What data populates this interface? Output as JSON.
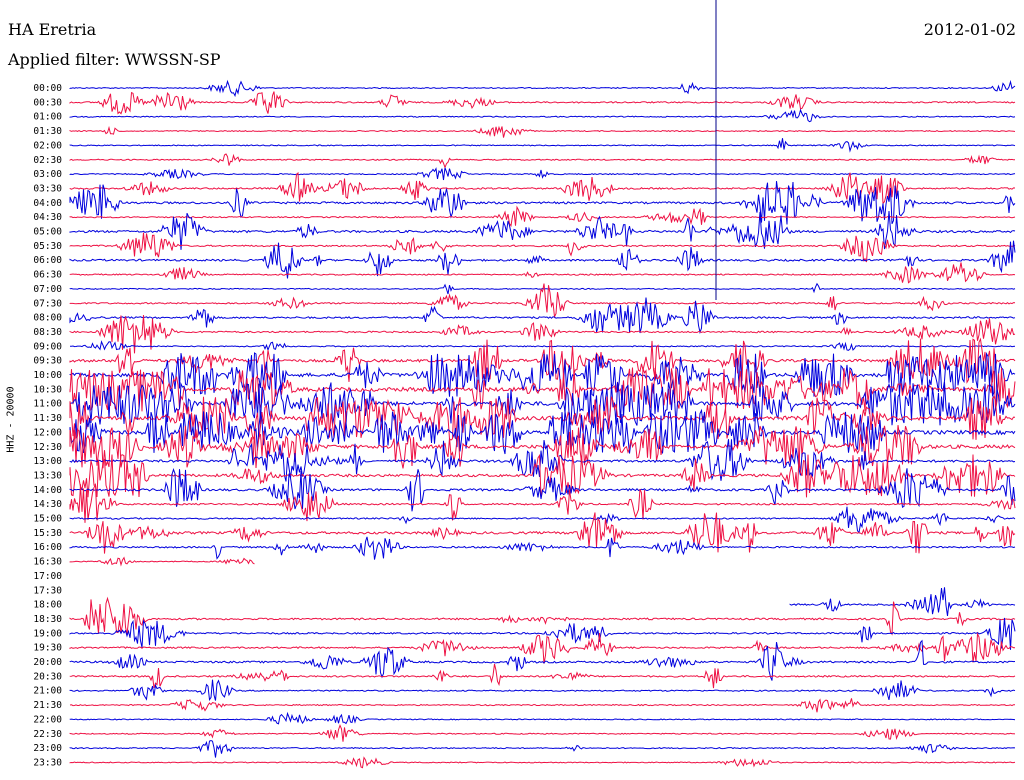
{
  "header": {
    "station": "HA Eretria",
    "filter": "Applied filter: WWSSN-SP",
    "date": "2012-01-02",
    "channel_label": "HHZ - 20000"
  },
  "colors": {
    "odd_trace": "#0000dd",
    "even_trace": "#ee1144",
    "marker_line": "#000088"
  },
  "chart_data": {
    "type": "line",
    "title": "HA Eretria",
    "subtitle": "Applied filter: WWSSN-SP",
    "ylabel": "HHZ - 20000",
    "y_tick_labels": [
      "00:00",
      "00:30",
      "01:00",
      "01:30",
      "02:00",
      "02:30",
      "03:00",
      "03:30",
      "04:00",
      "04:30",
      "05:00",
      "05:30",
      "06:00",
      "06:30",
      "07:00",
      "07:30",
      "08:00",
      "08:30",
      "09:00",
      "09:30",
      "10:00",
      "10:30",
      "11:00",
      "11:30",
      "12:00",
      "12:30",
      "13:00",
      "13:30",
      "14:00",
      "14:30",
      "15:00",
      "15:30",
      "16:00",
      "16:30",
      "17:00",
      "17:30",
      "18:00",
      "18:30",
      "19:00",
      "19:30",
      "20:00",
      "20:30",
      "21:00",
      "21:30",
      "22:00",
      "22:30",
      "23:00",
      "23:30"
    ],
    "row_activity": [
      0.8,
      2.0,
      0.6,
      0.7,
      0.6,
      1.0,
      0.8,
      2.5,
      4.0,
      1.2,
      4.5,
      2.2,
      3.5,
      1.5,
      0.5,
      2.0,
      3.0,
      2.5,
      1.0,
      6.0,
      9.0,
      10.0,
      10.0,
      10.0,
      10.0,
      9.0,
      5.0,
      6.0,
      4.5,
      2.5,
      2.0,
      5.0,
      2.5,
      0.5,
      0.0,
      0.0,
      2.5,
      3.0,
      2.5,
      2.5,
      3.5,
      2.5,
      1.5,
      1.0,
      0.5,
      0.8,
      1.0,
      0.4
    ],
    "data_ends_at": "16:30",
    "data_resumes_at": "18:00",
    "grid": false,
    "legend": "none"
  }
}
